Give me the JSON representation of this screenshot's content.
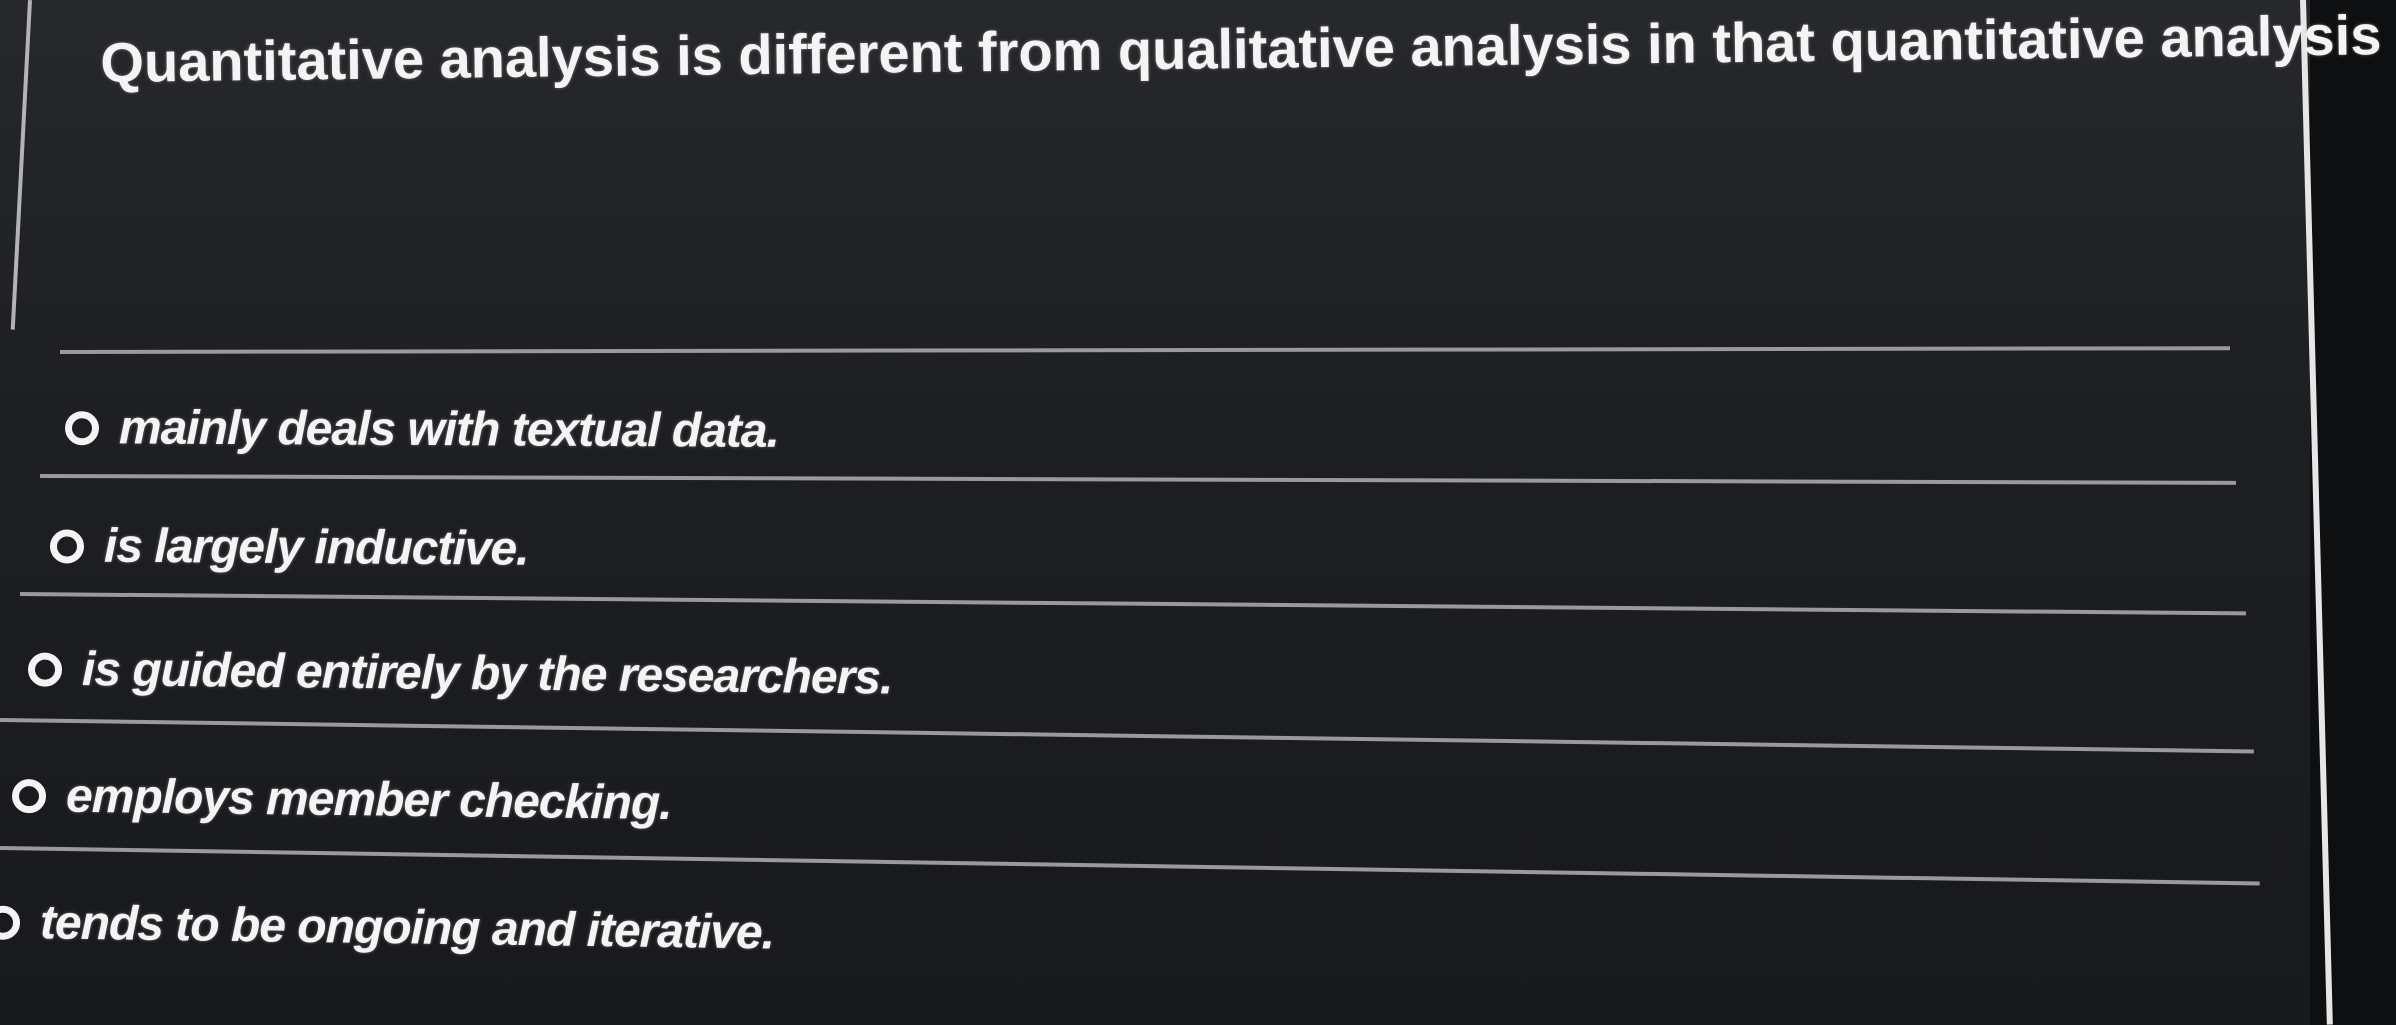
{
  "question": {
    "text": "Quantitative analysis is different from qualitative analysis in that quantitative analysis"
  },
  "options": [
    {
      "label": "mainly deals with textual data.",
      "selected": false
    },
    {
      "label": "is largely inductive.",
      "selected": false
    },
    {
      "label": "is guided entirely by the researchers.",
      "selected": false
    },
    {
      "label": "employs member checking.",
      "selected": false
    },
    {
      "label": "tends to be ongoing and iterative.",
      "selected": false
    }
  ]
}
